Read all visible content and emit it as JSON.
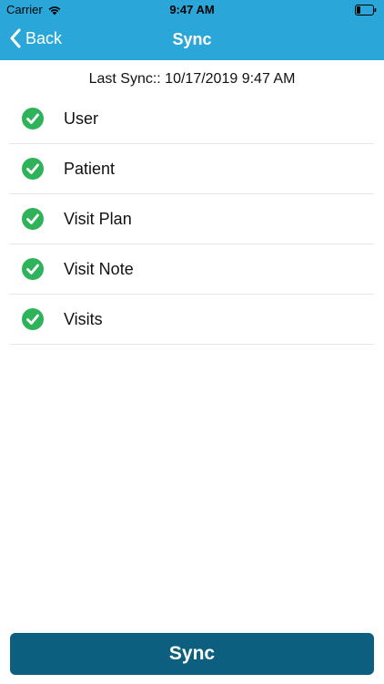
{
  "status_bar": {
    "carrier": "Carrier",
    "time": "9:47 AM"
  },
  "nav": {
    "back_label": "Back",
    "title": "Sync"
  },
  "last_sync": "Last Sync:: 10/17/2019 9:47 AM",
  "items": [
    {
      "label": "User",
      "status": "synced"
    },
    {
      "label": "Patient",
      "status": "synced"
    },
    {
      "label": "Visit Plan",
      "status": "synced"
    },
    {
      "label": "Visit Note",
      "status": "synced"
    },
    {
      "label": "Visits",
      "status": "synced"
    }
  ],
  "sync_button_label": "Sync",
  "colors": {
    "header": "#2aa7d8",
    "button": "#0c5f7e",
    "check": "#2fb35a"
  },
  "icons": {
    "status": [
      "wifi-icon",
      "battery-icon"
    ],
    "nav": "chevron-left-icon",
    "item": "check-circle-icon"
  }
}
